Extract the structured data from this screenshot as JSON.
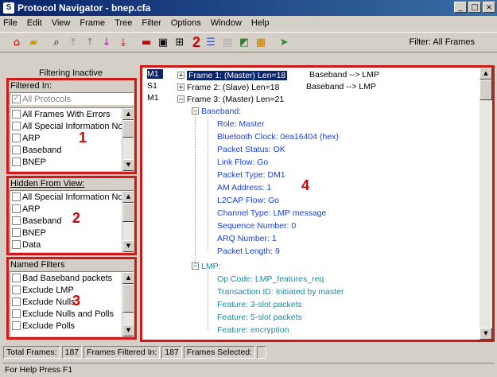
{
  "window": {
    "title": "Protocol Navigator - bnep.cfa",
    "controls": [
      "_",
      "□",
      "×"
    ]
  },
  "menu": [
    "File",
    "Edit",
    "View",
    "Frame",
    "Tree",
    "Filter",
    "Options",
    "Window",
    "Help"
  ],
  "toolbar": {
    "section_number": "2",
    "filter_label": "Filter:  All Frames"
  },
  "left": {
    "filtering_state": "Filtering Inactive",
    "filtered_in": {
      "header": "Filtered In:",
      "number": "1",
      "items": [
        {
          "label": "All Protocols",
          "checked": true,
          "disabled": true
        },
        {
          "label": "All Frames With Errors",
          "checked": false
        },
        {
          "label": "All Special Information Nodes",
          "checked": false
        },
        {
          "label": "ARP",
          "checked": false
        },
        {
          "label": "Baseband",
          "checked": false
        },
        {
          "label": "BNEP",
          "checked": false
        }
      ]
    },
    "hidden_from_view": {
      "header": "Hidden From View:",
      "number": "2",
      "items": [
        {
          "label": "All Special Information Nodes",
          "checked": false
        },
        {
          "label": "ARP",
          "checked": false
        },
        {
          "label": "Baseband",
          "checked": false
        },
        {
          "label": "BNEP",
          "checked": false
        },
        {
          "label": "Data",
          "checked": false
        }
      ]
    },
    "named_filters": {
      "header": "Named Filters",
      "number": "3",
      "items": [
        {
          "label": "Bad Baseband packets",
          "checked": false
        },
        {
          "label": "Exclude LMP",
          "checked": false
        },
        {
          "label": "Exclude Nulls",
          "checked": false
        },
        {
          "label": "Exclude Nulls and Polls",
          "checked": false
        },
        {
          "label": "Exclude Polls",
          "checked": false
        }
      ]
    }
  },
  "tree": {
    "number": "4",
    "frames": [
      {
        "id": "M1",
        "label": "Frame 1: (Master) Len=18",
        "dir": "Baseband --> LMP",
        "selected": true
      },
      {
        "id": "S1",
        "label": "Frame 2: (Slave) Len=18",
        "dir": "Baseband --> LMP",
        "selected": false
      },
      {
        "id": "M1",
        "label": "Frame 3: (Master) Len=21",
        "dir": "",
        "selected": false
      }
    ],
    "baseband": {
      "label": "Baseband:",
      "fields": [
        "Role: Master",
        "Bluetooth Clock: 0ea16404 (hex)",
        "Packet Status: OK",
        "Link Flow: Go",
        "Packet Type: DM1",
        "AM Address: 1",
        "L2CAP Flow: Go",
        "Channel Type: LMP message",
        "Sequence Number: 0",
        "ARQ Number: 1",
        "Packet Length: 9"
      ]
    },
    "lmp": {
      "label": "LMP:",
      "fields": [
        "Op Code: LMP_features_req",
        "Transaction ID: Initiated by master",
        "Feature: 3-slot packets",
        "Feature: 5-slot packets",
        "Feature: encryption"
      ]
    }
  },
  "status": {
    "total_frames_label": "Total Frames:",
    "total_frames": "187",
    "filtered_in_label": "Frames Filtered In:",
    "filtered_in": "187",
    "selected_label": "Frames Selected:",
    "selected": "",
    "help": "For Help Press F1"
  }
}
